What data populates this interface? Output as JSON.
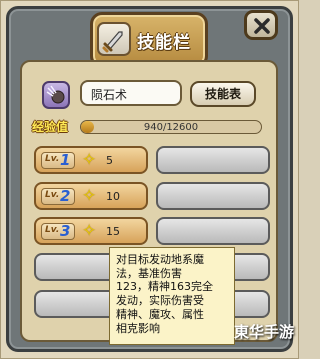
{
  "window": {
    "title": "技能栏",
    "title_icon": "sword-icon"
  },
  "skill": {
    "name": "陨石术",
    "icon": "meteor-icon",
    "list_button": "技能表"
  },
  "experience": {
    "label": "经验值",
    "current": 940,
    "max": 12600,
    "text": "940/12600"
  },
  "slots": [
    {
      "level_prefix": "Lv.",
      "level": "1",
      "value": "5"
    },
    {
      "level_prefix": "Lv.",
      "level": "2",
      "value": "10"
    },
    {
      "level_prefix": "Lv.",
      "level": "3",
      "value": "15"
    }
  ],
  "tooltip": {
    "lines": [
      "对目标发动地系魔",
      "法，基准伤害",
      "123，精神163完全",
      "发动，实际伤害受",
      "精神、魔攻、属性",
      "相克影响"
    ]
  },
  "watermark": "東华手游",
  "colors": {
    "panel": "#6f7678",
    "header": "#c79f55",
    "content": "#dfd2ac",
    "xp_fill": "#d59a35",
    "star": "#f2d200",
    "level_number": "#2a5fd1"
  }
}
